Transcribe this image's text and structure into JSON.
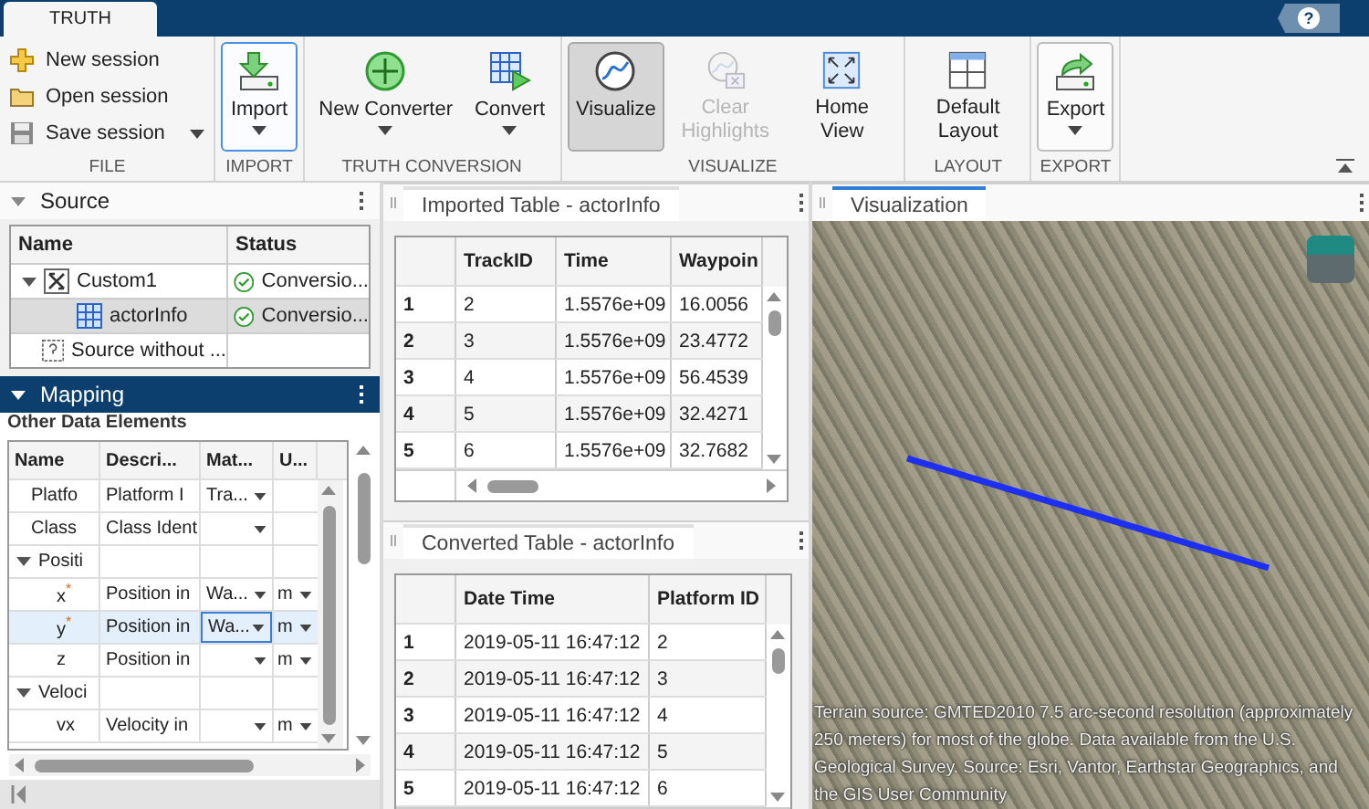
{
  "app_tab": {
    "label": "TRUTH",
    "selected": true
  },
  "help": "?",
  "ribbon": {
    "groups": [
      {
        "caption": "FILE",
        "buttons": [
          {
            "kind": "small",
            "label": "New session"
          },
          {
            "kind": "small",
            "label": "Open session"
          },
          {
            "kind": "small",
            "label": "Save session",
            "has_menu": true
          }
        ]
      },
      {
        "caption": "IMPORT",
        "buttons": [
          {
            "kind": "large",
            "label": "Import",
            "has_menu": true,
            "focused": true
          }
        ]
      },
      {
        "caption": "TRUTH CONVERSION",
        "buttons": [
          {
            "kind": "large",
            "label": "New Converter",
            "has_menu": true
          },
          {
            "kind": "large",
            "label": "Convert",
            "has_menu": true
          }
        ]
      },
      {
        "caption": "VISUALIZE",
        "buttons": [
          {
            "kind": "large",
            "label": "Visualize",
            "pressed": true
          },
          {
            "kind": "large",
            "label": "Clear Highlights",
            "disabled": true
          },
          {
            "kind": "large",
            "label": "Home View"
          }
        ]
      },
      {
        "caption": "LAYOUT",
        "buttons": [
          {
            "kind": "large",
            "label": "Default Layout"
          }
        ]
      },
      {
        "caption": "EXPORT",
        "buttons": [
          {
            "kind": "large",
            "label": "Export",
            "has_menu": true,
            "framed": true
          }
        ]
      }
    ]
  },
  "source": {
    "title": "Source",
    "expanded": true,
    "columns": [
      "Name",
      "Status"
    ],
    "rows": [
      {
        "name": "Custom1",
        "status": "Conversio...",
        "status_ok": true,
        "expanded": true,
        "selected": false,
        "children": [
          {
            "name": "actorInfo",
            "status": "Conversio...",
            "status_ok": true,
            "selected": true
          }
        ]
      },
      {
        "name": "Source without ...",
        "selected": false
      }
    ]
  },
  "mapping": {
    "title": "Mapping",
    "expanded": true,
    "section": "Other Data Elements",
    "columns": [
      "Name",
      "Descri...",
      "Mat...",
      "U..."
    ],
    "rows": [
      {
        "name": "Platfo",
        "description": "Platform I",
        "matched": "Tra...",
        "matched_menu": true,
        "selected": false
      },
      {
        "name": "Class",
        "description": "Class Ident",
        "matched_menu": true,
        "selected": false
      },
      {
        "name": "Positi",
        "expanded": true,
        "selected": false,
        "children": [
          {
            "name": "x$^{*}$",
            "description": "Position in",
            "matched": "Wa...",
            "matched_menu": true,
            "units": "m",
            "units_menu": true,
            "selected": false
          },
          {
            "name": "y$^{*}$",
            "description": "Position in",
            "matched": "Wa...",
            "matched_menu": true,
            "matched_focused": true,
            "units": "m",
            "units_menu": true,
            "selected": true
          },
          {
            "name": "z",
            "description": "Position in",
            "matched_menu": true,
            "units": "m",
            "units_menu": true,
            "selected": false
          }
        ]
      },
      {
        "name": "Veloci",
        "expanded": true,
        "selected": false,
        "children": [
          {
            "name": "vx",
            "description": "Velocity in",
            "matched_menu": true,
            "units": "m",
            "units_menu": true,
            "selected": false
          }
        ]
      }
    ]
  },
  "imported": {
    "title": "Imported Table - actorInfo",
    "active": false,
    "columns": [
      "",
      "TrackID",
      "Time",
      "Waypoin"
    ],
    "rows": [
      [
        "1",
        "2",
        "1.5576e+09",
        "16.0056"
      ],
      [
        "2",
        "3",
        "1.5576e+09",
        "23.4772"
      ],
      [
        "3",
        "4",
        "1.5576e+09",
        "56.4539"
      ],
      [
        "4",
        "5",
        "1.5576e+09",
        "32.4271"
      ],
      [
        "5",
        "6",
        "1.5576e+09",
        "32.7682"
      ]
    ]
  },
  "converted": {
    "title": "Converted Table - actorInfo",
    "active": false,
    "columns": [
      "",
      "Date Time",
      "Platform ID"
    ],
    "rows": [
      [
        "1",
        "2019-05-11 16:47:12",
        "2"
      ],
      [
        "2",
        "2019-05-11 16:47:12",
        "3"
      ],
      [
        "3",
        "2019-05-11 16:47:12",
        "4"
      ],
      [
        "4",
        "2019-05-11 16:47:12",
        "5"
      ],
      [
        "5",
        "2019-05-11 16:47:12",
        "6"
      ]
    ]
  },
  "visualization": {
    "title": "Visualization",
    "active": true,
    "attribution": "Terrain source: GMTED2010 7.5 arc-second resolution (approximately 250 meters) for most of the globe. Data available from the U.S. Geological Survey. Source: Esri, Vantor, Earthstar Geographics, and the GIS User Community"
  }
}
